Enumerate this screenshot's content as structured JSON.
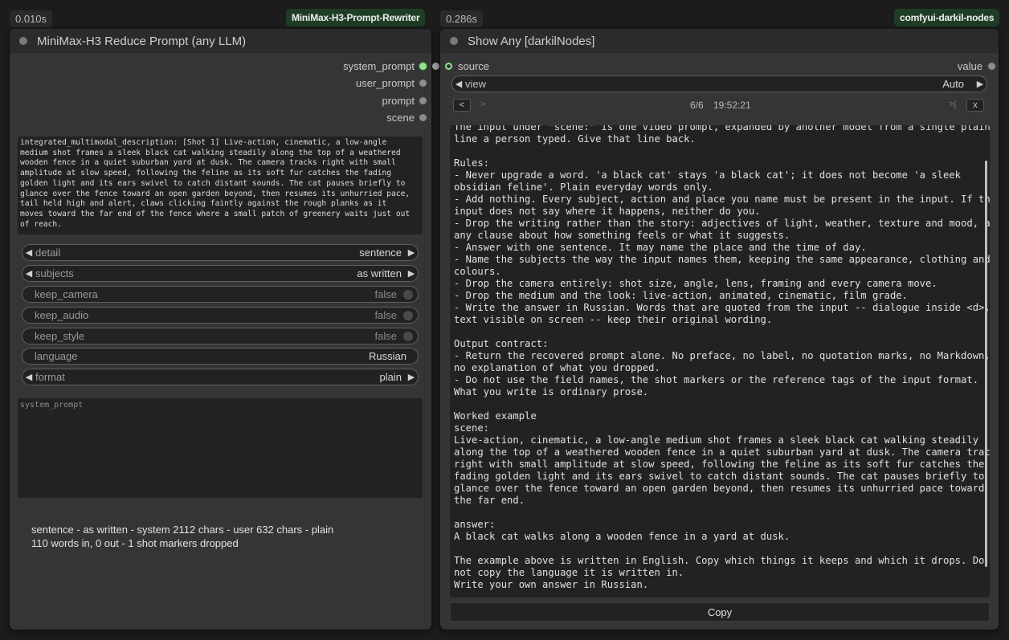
{
  "left_node": {
    "timing": "0.010s",
    "badge": "MiniMax-H3-Prompt-Rewriter",
    "title": "MiniMax-H3 Reduce Prompt (any LLM)",
    "outputs": [
      "system_prompt",
      "user_prompt",
      "prompt",
      "scene"
    ],
    "input_text": "integrated_multimodal_description: [Shot 1] Live-action, cinematic, a low-angle\nmedium shot frames a sleek black cat walking steadily along the top of a weathered\nwooden fence in a quiet suburban yard at dusk. The camera tracks right with small\namplitude at slow speed, following the feline as its soft fur catches the fading\ngolden light and its ears swivel to catch distant sounds. The cat pauses briefly to\nglance over the fence toward an open garden beyond, then resumes its unhurried pace,\ntail held high and alert, claws clicking faintly against the rough planks as it\nmoves toward the far end of the fence where a small patch of greenery waits just out\nof reach.",
    "widgets": {
      "detail": {
        "label": "detail",
        "value": "sentence"
      },
      "subjects": {
        "label": "subjects",
        "value": "as written"
      },
      "keep_camera": {
        "label": "keep_camera",
        "value": "false"
      },
      "keep_audio": {
        "label": "keep_audio",
        "value": "false"
      },
      "keep_style": {
        "label": "keep_style",
        "value": "false"
      },
      "language": {
        "label": "language",
        "value": "Russian"
      },
      "format": {
        "label": "format",
        "value": "plain"
      }
    },
    "system_prompt_placeholder": "system_prompt",
    "summary_line1": "sentence - as written - system 2112 chars - user 632 chars - plain",
    "summary_line2": "110 words in, 0 out - 1 shot markers dropped"
  },
  "right_node": {
    "timing": "0.286s",
    "badge": "comfyui-darkil-nodes",
    "title": "Show Any [darkilNodes]",
    "input_label": "source",
    "output_label": "value",
    "view_label": "view",
    "view_value": "Auto",
    "nav": {
      "prev": "<",
      "next": ">",
      "page": "6/6",
      "time": "19:52:21",
      "last": ">|",
      "close": "x"
    },
    "content": "The input under \"scene:\" is one video prompt, expanded by another model from a single plain\nline a person typed. Give that line back.\n\nRules:\n- Never upgrade a word. 'a black cat' stays 'a black cat'; it does not become 'a sleek\nobsidian feline'. Plain everyday words only.\n- Add nothing. Every subject, action and place you name must be present in the input. If the\ninput does not say where it happens, neither do you.\n- Drop the writing rather than the story: adjectives of light, weather, texture and mood, and\nany clause about how something feels or what it suggests.\n- Answer with one sentence. It may name the place and the time of day.\n- Name the subjects the way the input names them, keeping the same appearance, clothing and\ncolours.\n- Drop the camera entirely: shot size, angle, lens, framing and every camera move.\n- Drop the medium and the look: live-action, animated, cinematic, film grade.\n- Write the answer in Russian. Words that are quoted from the input -- dialogue inside <d>,\ntext visible on screen -- keep their original wording.\n\nOutput contract:\n- Return the recovered prompt alone. No preface, no label, no quotation marks, no Markdown,\nno explanation of what you dropped.\n- Do not use the field names, the shot markers or the reference tags of the input format.\nWhat you write is ordinary prose.\n\nWorked example\nscene:\nLive-action, cinematic, a low-angle medium shot frames a sleek black cat walking steadily\nalong the top of a weathered wooden fence in a quiet suburban yard at dusk. The camera tracks\nright with small amplitude at slow speed, following the feline as its soft fur catches the\nfading golden light and its ears swivel to catch distant sounds. The cat pauses briefly to\nglance over the fence toward an open garden beyond, then resumes its unhurried pace toward\nthe far end.\n\nanswer:\nA black cat walks along a wooden fence in a yard at dusk.\n\nThe example above is written in English. Copy which things it keeps and which it drops. Do\nnot copy the language it is written in.\nWrite your own answer in Russian.",
    "copy_label": "Copy"
  }
}
